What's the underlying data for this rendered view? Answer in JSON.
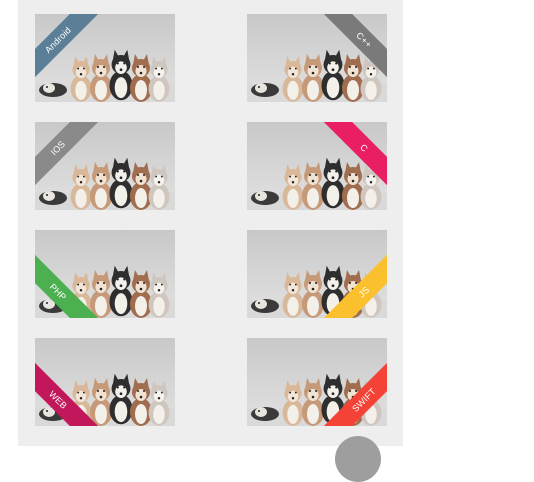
{
  "cards": [
    {
      "label": "Android",
      "color": "#5b7f97",
      "corner": "top-left"
    },
    {
      "label": "C++",
      "color": "#7a7a7a",
      "corner": "top-right"
    },
    {
      "label": "IOS",
      "color": "#8a8a8a",
      "corner": "top-left"
    },
    {
      "label": "C",
      "color": "#e91e63",
      "corner": "top-right"
    },
    {
      "label": "PHP",
      "color": "#4caf50",
      "corner": "bottom-left"
    },
    {
      "label": "JS",
      "color": "#fbc02d",
      "corner": "bottom-right"
    },
    {
      "label": "WEB",
      "color": "#c2185b",
      "corner": "bottom-left"
    },
    {
      "label": "SWIFT",
      "color": "#f44336",
      "corner": "bottom-right"
    }
  ],
  "photo": {
    "subject": "husky-puppies-photo"
  }
}
